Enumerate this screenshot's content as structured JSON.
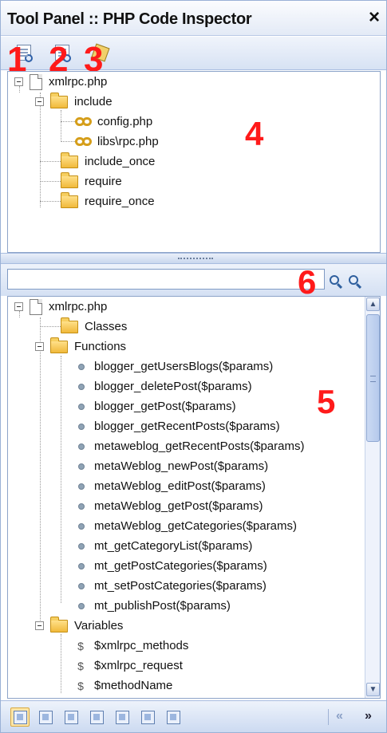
{
  "title_bar": {
    "title": "Tool Panel :: PHP Code Inspector",
    "close_glyph": "×"
  },
  "toolbar": {
    "buttons": [
      {
        "name": "inspect-file-icon"
      },
      {
        "name": "inspect-folder-icon"
      },
      {
        "name": "tag-properties-icon"
      }
    ]
  },
  "callouts": {
    "n1": "1",
    "n2": "2",
    "n3": "3",
    "n4": "4",
    "n5": "5",
    "n6": "6"
  },
  "includes_tree": {
    "root": "xmlrpc.php",
    "items": [
      "include",
      "config.php",
      "libs\\rpc.php",
      "include_once",
      "require",
      "require_once"
    ]
  },
  "search": {
    "value": "",
    "placeholder": ""
  },
  "structure_tree": {
    "root": "xmlrpc.php",
    "classes_label": "Classes",
    "functions_label": "Functions",
    "functions": [
      "blogger_getUsersBlogs($params)",
      "blogger_deletePost($params)",
      "blogger_getPost($params)",
      "blogger_getRecentPosts($params)",
      "metaweblog_getRecentPosts($params)",
      "metaWeblog_newPost($params)",
      "metaWeblog_editPost($params)",
      "metaWeblog_getPost($params)",
      "metaWeblog_getCategories($params)",
      "mt_getCategoryList($params)",
      "mt_getPostCategories($params)",
      "mt_setPostCategories($params)",
      "mt_publishPost($params)"
    ],
    "variables_label": "Variables",
    "dollar_glyph": "$",
    "variables": [
      "$xmlrpc_methods",
      "$xmlrpc_request",
      "$methodName"
    ]
  },
  "scrollbar": {
    "up": "▲",
    "down": "▼"
  },
  "bottom_bar": {
    "prev": "«",
    "next": "»"
  }
}
